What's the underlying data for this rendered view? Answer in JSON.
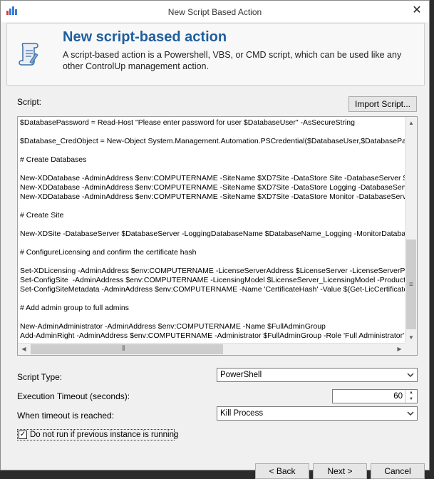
{
  "window": {
    "title": "New Script Based Action",
    "close_symbol": "✕"
  },
  "header": {
    "title": "New script-based action",
    "description": "A script-based action is a Powershell, VBS, or CMD script, which can be used like any other ControlUp management action."
  },
  "script_section": {
    "label": "Script:",
    "import_button": "Import Script...",
    "lines": [
      "$DatabasePassword = Read-Host \"Please enter password for user $DatabaseUser\" -AsSecureString",
      "",
      "$Database_CredObject = New-Object System.Management.Automation.PSCredential($DatabaseUser,$DatabasePassword)",
      "",
      "# Create Databases",
      "",
      "New-XDDatabase -AdminAddress $env:COMPUTERNAME -SiteName $XD7Site -DataStore Site -DatabaseServer $DatabaseServer",
      "New-XDDatabase -AdminAddress $env:COMPUTERNAME -SiteName $XD7Site -DataStore Logging -DatabaseServer $DatabaseServer",
      "New-XDDatabase -AdminAddress $env:COMPUTERNAME -SiteName $XD7Site -DataStore Monitor -DatabaseServer $DatabaseServer",
      "",
      "# Create Site",
      "",
      "New-XDSite -DatabaseServer $DatabaseServer -LoggingDatabaseName $DatabaseName_Logging -MonitorDatabaseName",
      "",
      "# ConfigureLicensing and confirm the certificate hash",
      "",
      "Set-XDLicensing -AdminAddress $env:COMPUTERNAME -LicenseServerAddress $LicenseServer -LicenseServerPort",
      "Set-ConfigSite  -AdminAddress $env:COMPUTERNAME -LicensingModel $LicenseServer_LicensingModel -ProductCode",
      "Set-ConfigSiteMetadata -AdminAddress $env:COMPUTERNAME -Name 'CertificateHash' -Value $(Get-LicCertificate",
      "",
      "# Add admin group to full admins",
      "",
      "New-AdminAdministrator -AdminAddress $env:COMPUTERNAME -Name $FullAdminGroup",
      "Add-AdminRight -AdminAddress $env:COMPUTERNAME -Administrator $FullAdminGroup -Role 'Full Administrator' -All"
    ]
  },
  "form": {
    "script_type_label": "Script Type:",
    "script_type_value": "PowerShell",
    "timeout_label": "Execution Timeout (seconds):",
    "timeout_value": "60",
    "when_timeout_label": "When timeout is reached:",
    "when_timeout_value": "Kill Process",
    "do_not_run_label": "Do not run if previous instance is running",
    "do_not_run_checked": true
  },
  "footer": {
    "back": "< Back",
    "next": "Next >",
    "cancel": "Cancel"
  },
  "colors": {
    "title_blue": "#1f5e9e",
    "dialog_bg": "#f0f0f0"
  }
}
